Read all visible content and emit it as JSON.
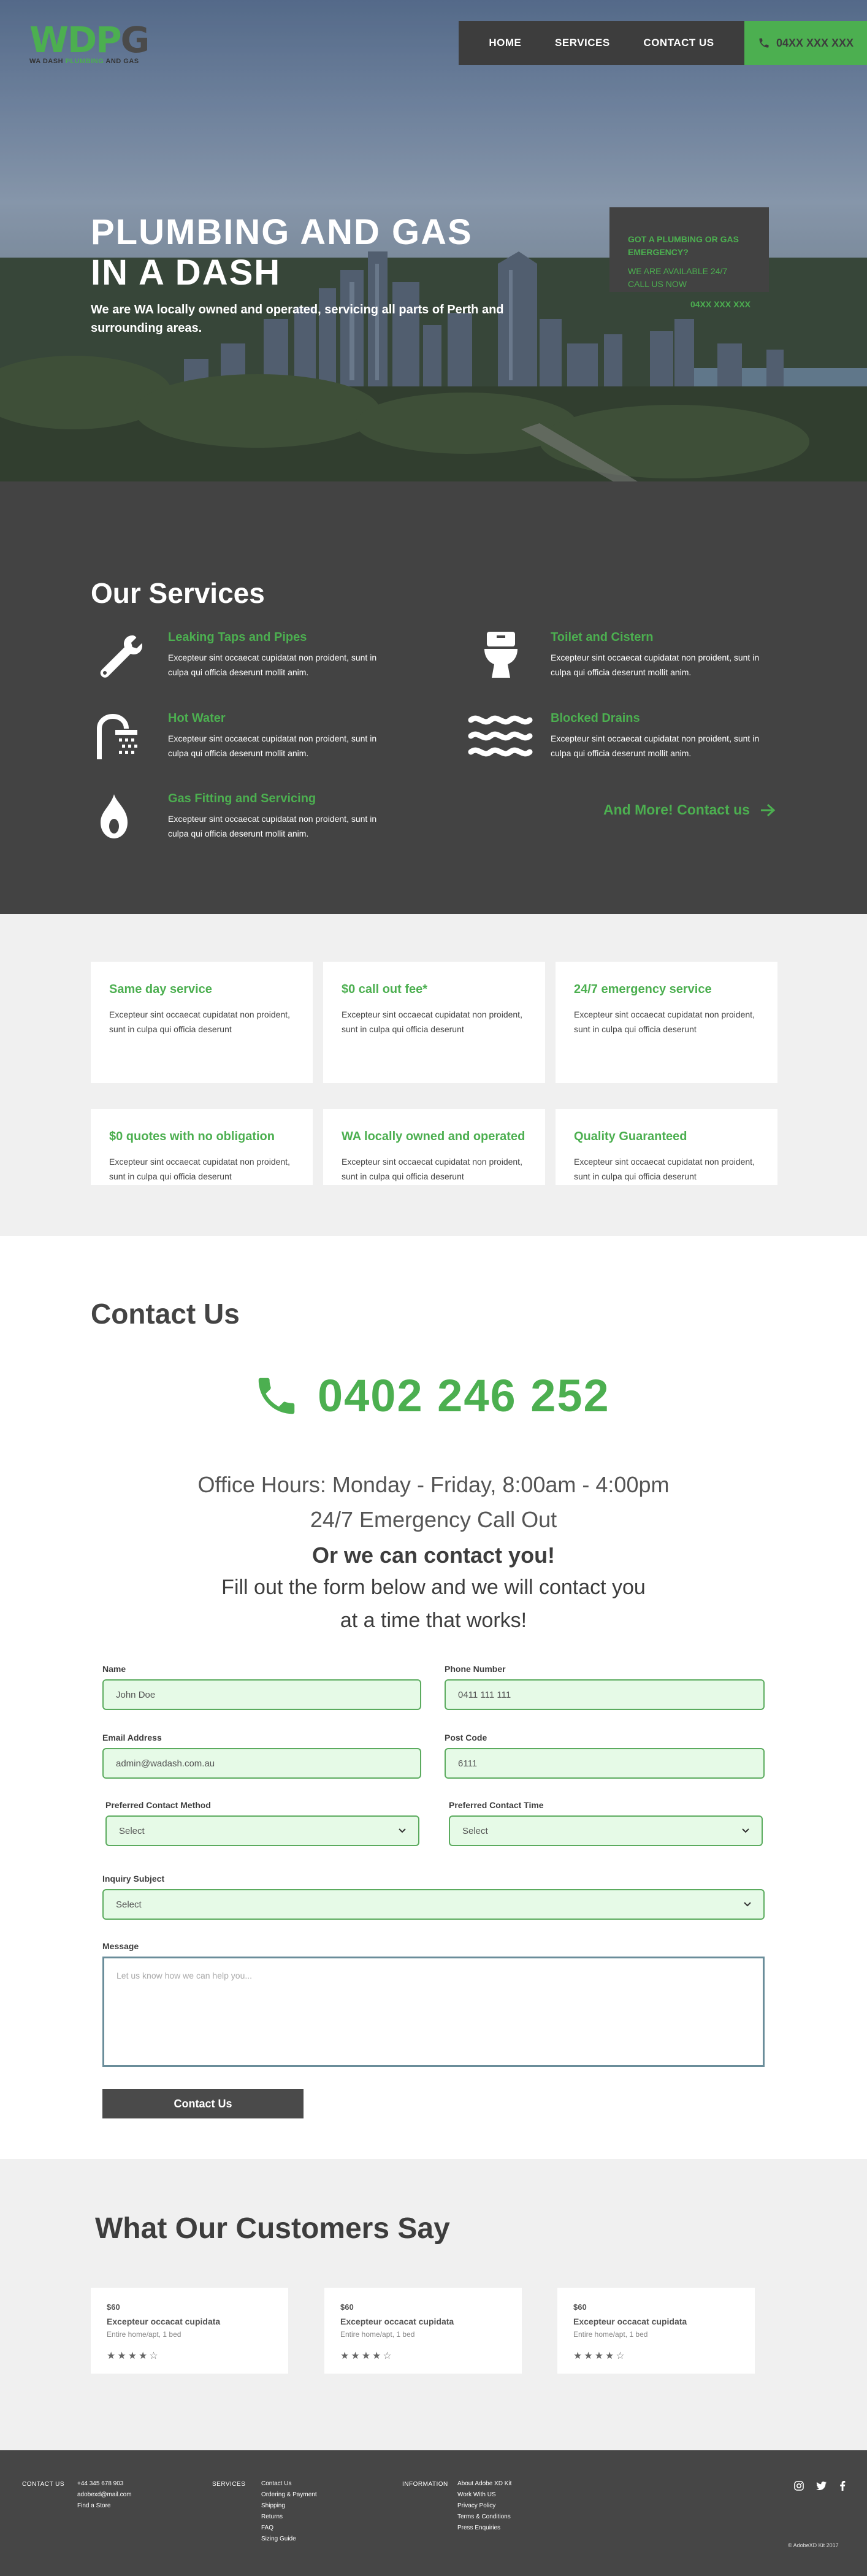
{
  "header": {
    "logo_mark_a": "WD",
    "logo_mark_b": "P",
    "logo_mark_c": "G",
    "logo_tag_a": "WA DASH ",
    "logo_tag_b": "PLUMBING",
    "logo_tag_c": " AND GAS",
    "nav": [
      "HOME",
      "SERVICES",
      "CONTACT US"
    ],
    "phone": "04XX XXX XXX"
  },
  "hero": {
    "title_line1": "PLUMBING AND GAS",
    "title_line2": "IN A DASH",
    "subtitle": "We are WA locally owned and operated, servicing all parts of Perth and surrounding areas.",
    "emergency_line1": "GOT A PLUMBING OR GAS EMERGENCY?",
    "emergency_line2": "WE ARE AVAILABLE 24/7 CALL US NOW",
    "emergency_phone": "04XX XXX XXX"
  },
  "services": {
    "title": "Our Services",
    "items": [
      {
        "title": "Leaking Taps and Pipes",
        "desc": "Excepteur sint occaecat cupidatat non proident, sunt in culpa qui officia deserunt mollit anim.",
        "icon": "wrench-icon"
      },
      {
        "title": "Toilet and Cistern",
        "desc": "Excepteur sint occaecat cupidatat non proident, sunt in culpa qui officia deserunt mollit anim.",
        "icon": "toilet-icon"
      },
      {
        "title": "Hot Water",
        "desc": "Excepteur sint occaecat cupidatat non proident, sunt in culpa qui officia deserunt mollit anim.",
        "icon": "shower-icon"
      },
      {
        "title": "Blocked Drains",
        "desc": "Excepteur sint occaecat cupidatat non proident, sunt in culpa qui officia deserunt mollit anim.",
        "icon": "waves-icon"
      },
      {
        "title": "Gas Fitting and Servicing",
        "desc": "Excepteur sint occaecat cupidatat non proident, sunt in culpa qui officia deserunt mollit anim.",
        "icon": "flame-icon"
      }
    ],
    "more": "And More! Contact us"
  },
  "features": [
    {
      "title": "Same day service",
      "desc": "Excepteur sint occaecat cupidatat non proident, sunt in culpa qui officia deserunt"
    },
    {
      "title": "$0 call out fee*",
      "desc": "Excepteur sint occaecat cupidatat non proident, sunt in culpa qui officia deserunt"
    },
    {
      "title": "24/7 emergency service",
      "desc": "Excepteur sint occaecat cupidatat non proident, sunt in culpa qui officia deserunt"
    },
    {
      "title": "$0 quotes with no obligation",
      "desc": "Excepteur sint occaecat cupidatat non proident, sunt in culpa qui officia deserunt"
    },
    {
      "title": "WA locally owned and operated",
      "desc": "Excepteur sint occaecat cupidatat non proident, sunt in culpa qui officia deserunt"
    },
    {
      "title": "Quality Guaranteed",
      "desc": "Excepteur sint occaecat cupidatat non proident, sunt in culpa qui officia deserunt"
    }
  ],
  "contact": {
    "title": "Contact Us",
    "phone": "0402 246 252",
    "hours": "Office Hours: Monday - Friday, 8:00am - 4:00pm",
    "callout": "24/7 Emergency Call Out",
    "or_contact": "Or we can contact you!",
    "fill_line1": "Fill out the form below and we will contact you",
    "fill_line2": "at a time that works!",
    "form": {
      "name_label": "Name",
      "name_value": "John Doe",
      "phone_label": "Phone Number",
      "phone_value": "0411 111 111",
      "email_label": "Email Address",
      "email_value": "admin@wadash.com.au",
      "postcode_label": "Post Code",
      "postcode_value": "6111",
      "method_label": "Preferred Contact Method",
      "method_value": "Select",
      "time_label": "Preferred Contact Time",
      "time_value": "Select",
      "subject_label": "Inquiry Subject",
      "subject_value": "Select",
      "message_label": "Message",
      "message_placeholder": "Let us know how we can help you...",
      "submit": "Contact Us"
    }
  },
  "testimonials": {
    "title": "What Our Customers Say",
    "items": [
      {
        "price": "$60",
        "title": "Excepteur occacat cupidata",
        "sub": "Entire home/apt, 1 bed",
        "stars": "★★★★☆"
      },
      {
        "price": "$60",
        "title": "Excepteur occacat cupidata",
        "sub": "Entire home/apt, 1 bed",
        "stars": "★★★★☆"
      },
      {
        "price": "$60",
        "title": "Excepteur occacat cupidata",
        "sub": "Entire home/apt, 1 bed",
        "stars": "★★★★☆"
      }
    ]
  },
  "footer": {
    "contact_head": "CONTACT US",
    "contact_items": [
      "+44 345 678 903",
      "adobexd@mail.com",
      "Find a Store"
    ],
    "services_head": "SERVICES",
    "services_items": [
      "Contact Us",
      "Ordering & Payment",
      "Shipping",
      "Returns",
      "FAQ",
      "Sizing Guide"
    ],
    "info_head": "INFORMATION",
    "info_items": [
      "About Adobe XD Kit",
      "Work With US",
      "Privacy Policy",
      "Terms & Conditions",
      "Press Enquiries"
    ],
    "copyright": "© AdobeXD Kit 2017"
  },
  "colors": {
    "accent": "#4caf50",
    "dark": "#434343",
    "light": "#f0f0f0",
    "field": "#e6fae7"
  }
}
